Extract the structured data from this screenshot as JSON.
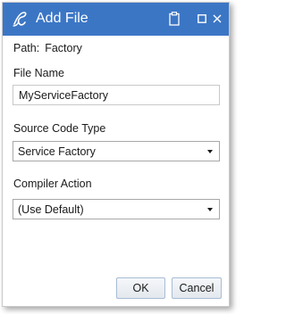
{
  "window": {
    "title": "Add File",
    "icon": "app-logo-icon",
    "controls": [
      "clipboard-icon",
      "maximize-icon",
      "close-icon"
    ]
  },
  "path": {
    "label": "Path:",
    "value": "Factory"
  },
  "file_name": {
    "label": "File Name",
    "value": "MyServiceFactory"
  },
  "source_code_type": {
    "label": "Source Code Type",
    "selected": "Service Factory"
  },
  "compiler_action": {
    "label": "Compiler Action",
    "selected": "(Use Default)"
  },
  "buttons": {
    "ok": "OK",
    "cancel": "Cancel"
  },
  "colors": {
    "titlebar": "#3b76c5",
    "button_border": "#a8bcd6"
  }
}
